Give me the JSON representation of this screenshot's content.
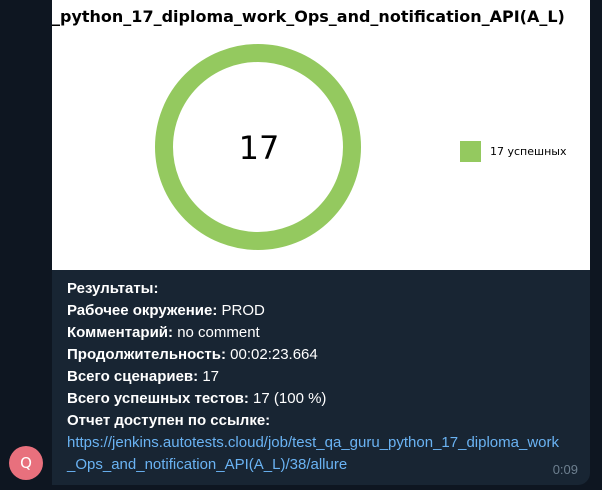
{
  "avatar": {
    "initial": "Q"
  },
  "report_image": {
    "title": "_python_17_diploma_work_Ops_and_notification_API(A_L)",
    "center_value": "17",
    "legend_label": "17 успешных"
  },
  "chart_data": {
    "type": "pie",
    "title": "_python_17_diploma_work_Ops_and_notification_API(A_L)",
    "categories": [
      "17 успешных"
    ],
    "values": [
      17
    ],
    "colors": [
      "#94c95f"
    ],
    "donut": true,
    "center_label": "17",
    "legend": "right"
  },
  "results": {
    "heading": "Результаты:",
    "environment_label": "Рабочее окружение:",
    "environment_value": "PROD",
    "comment_label": "Комментарий:",
    "comment_value": "no comment",
    "duration_label": "Продолжительность:",
    "duration_value": "00:02:23.664",
    "scenarios_label": "Всего сценариев:",
    "scenarios_value": "17",
    "passed_label": "Всего успешных тестов:",
    "passed_value": "17 (100 %)",
    "report_label": "Отчет доступен по ссылке:",
    "report_url": "https://jenkins.autotests.cloud/job/test_qa_guru_python_17_diploma_work_Ops_and_notification_API(A_L)/38/allure"
  },
  "message": {
    "time": "0:09"
  },
  "colors": {
    "background": "#0e1621",
    "bubble": "#182533",
    "link": "#6ab3f3",
    "success": "#94c95f"
  }
}
